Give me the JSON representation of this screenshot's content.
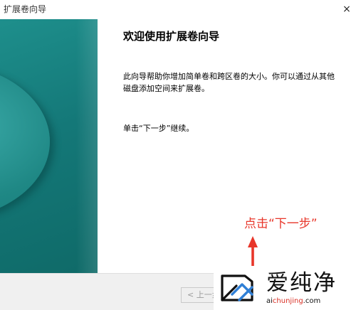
{
  "window": {
    "title": "扩展卷向导",
    "close_glyph": "×"
  },
  "content": {
    "heading": "欢迎使用扩展卷向导",
    "description": "此向导帮助你增加简单卷和跨区卷的大小。你可以通过从其他磁盘添加空间来扩展卷。",
    "hint": "单击“下一步”继续。"
  },
  "annotation": {
    "text": "点击“下一步”",
    "color": "#e8362a"
  },
  "footer": {
    "back_label": "< 上一步"
  },
  "watermark": {
    "brand": "爱纯净",
    "url_prefix": "ai",
    "url_highlight": "chunjing",
    "url_suffix": ".com"
  },
  "colors": {
    "side_panel": "#147878",
    "footer_bg": "#f0f0f0",
    "annotation_red": "#e8362a"
  }
}
